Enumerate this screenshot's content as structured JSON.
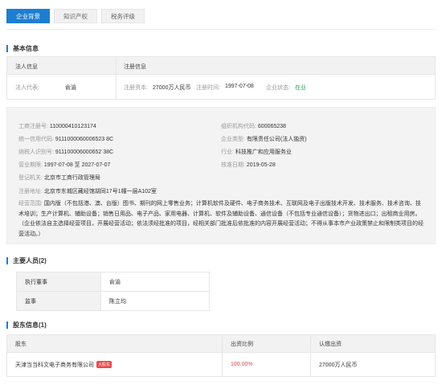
{
  "tabs": [
    {
      "label": "企业背景"
    },
    {
      "label": "知识产权"
    },
    {
      "label": "税务评级"
    }
  ],
  "basic": {
    "title": "基本信息",
    "legal_header": "法人信息",
    "reg_header": "注册信息",
    "legal_rep_label": "法人代表:",
    "legal_rep_value": "俞渝",
    "capital_label": "注册资本:",
    "capital_value": "27000万人民币",
    "reg_time_label": "注册时间:",
    "reg_time_value": "1997-07-08",
    "status_label": "企业状态:",
    "status_value": "在业"
  },
  "registration": {
    "biz_reg_label": "工商注册号:",
    "biz_reg_value": "110000410123174",
    "org_code_label": "组织机构代码:",
    "org_code_value": "600065238",
    "credit_code_label": "统一信用代码:",
    "credit_code_value": "9111000060006523 8C",
    "company_type_label": "企业类型:",
    "company_type_value": "有限责任公司(法人独资)",
    "taxpayer_label": "纳税人识别号:",
    "taxpayer_value": "911100006000652 38C",
    "industry_label": "行业:",
    "industry_value": "科技推广和应用服务业",
    "term_label": "营业期限:",
    "term_value": "1997-07-08 至 2027-07-07",
    "approval_label": "核准日期:",
    "approval_value": "2019-05-28",
    "authority_label": "登记机关:",
    "authority_value": "北京市工商行政管理局",
    "address_label": "注册地址:",
    "address_value": "北京市东城区藏经馆胡同17号1幢一层A102室",
    "scope_label": "经营范围:",
    "scope_value": "国内版（不包括港、澳、台版）图书、期刊的网上零售业务；计算机软件及硬件、电子商务技术、互联网及电子出版技术开发、技术服务、技术咨询、技术培训；生产计算机、辅助设备；销售日用品、电子产品、家用电器、计算机、软件及辅助设备、通信设备（不包括专业通信设备）；货物进出口；出租商业用房。（企业依法自主选择经营项目，开展经营活动；依法须经批准的项目，经相关部门批准后依批准的内容开展经营活动；不得从事本市产业政策禁止和限制类项目的经营活动。）"
  },
  "staff": {
    "title": "主要人员(2)",
    "rows": [
      {
        "role": "执行董事",
        "name": "俞渝"
      },
      {
        "role": "监事",
        "name": "陈立均"
      }
    ]
  },
  "shareholders": {
    "title": "股东信息(1)",
    "headers": {
      "holder": "股东",
      "ratio": "出资比例",
      "amount": "认缴出资"
    },
    "rows": [
      {
        "holder": "天津当当科文电子商务有限公司",
        "badge": "大股东",
        "ratio": "100.00%",
        "amount": "27000万人民币"
      }
    ]
  },
  "colors": {
    "accent": "#1d7ed0",
    "status_green": "#26a65b",
    "ratio_red": "#e04a4a"
  }
}
